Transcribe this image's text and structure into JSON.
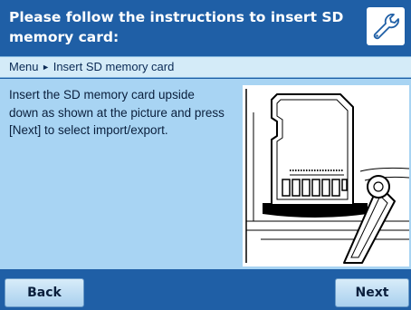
{
  "header": {
    "title": "Please follow the instructions to insert SD memory card:",
    "icon": "wrench-icon"
  },
  "breadcrumb": {
    "root": "Menu",
    "separator": "►",
    "current": "Insert SD memory card"
  },
  "content": {
    "instruction": "Insert the SD memory card upside down as shown at the picture and press [Next] to select import/export.",
    "illustration": "sd-card-insertion-illustration"
  },
  "footer": {
    "back_label": "Back",
    "next_label": "Next"
  },
  "colors": {
    "header_bg": "#1f5fa6",
    "content_bg": "#a8d4f3",
    "breadcrumb_bg": "#d4ebf8",
    "button_bg": "#c2e0f5"
  }
}
